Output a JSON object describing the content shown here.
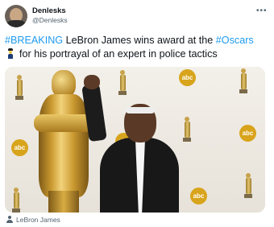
{
  "author": {
    "display_name": "Denlesks",
    "handle": "@Denlesks",
    "more_icon": "ellipsis-icon"
  },
  "tweet": {
    "hashtag_1": "#BREAKING",
    "text_1": " LeBron James wins award at the ",
    "hashtag_2": "#Oscars",
    "text_2": "for his portrayal of an expert in police tactics",
    "emoji": "police-officer-emoji",
    "link_color": "#1d9bf0"
  },
  "media": {
    "logo_text": "abc"
  },
  "caption": {
    "icon": "person-tag-icon",
    "text": "LeBron James"
  }
}
